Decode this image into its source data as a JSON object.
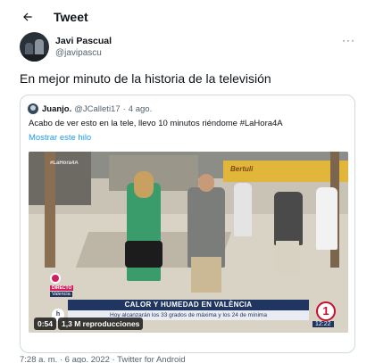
{
  "header": {
    "back_icon": "arrow-left-icon",
    "title": "Tweet"
  },
  "author": {
    "name": "Javi Pascual",
    "handle": "@javipascu",
    "more_icon": "more-horizontal-icon",
    "more_glyph": "···"
  },
  "tweet": {
    "text": "En mejor minuto de la historia de la televisión"
  },
  "quote": {
    "name": "Juanjo.",
    "handle": "@JCalleti17",
    "separator": "·",
    "time": "4 ago.",
    "text": "Acabo de ver esto en la tele, llevo 10 minutos riéndome #LaHora4A",
    "show_thread": "Mostrar este hilo",
    "video": {
      "corner_tag": "#LaHora4A",
      "awning_text": "Bertuli",
      "live_label": "DIRECTO",
      "live_city": "Valencia",
      "banner": "CALOR Y HUMEDAD EN VALÈNCIA",
      "sub_banner": "Hoy alcanzarán los 33 grados de máxima y los 24 de mínima",
      "channel_logo": "1",
      "show_logo": "h",
      "clock": "12:22",
      "duration": "0:54",
      "views": "1,3 M reproducciones"
    }
  },
  "footer": {
    "text": "7:28 a. m. · 6 ago. 2022 · Twitter for Android"
  },
  "colors": {
    "link": "#1d9bf0",
    "secondary_text": "#536471",
    "border": "#cfd9de",
    "tve_red": "#c8102e",
    "tve_navy": "#20355f"
  }
}
